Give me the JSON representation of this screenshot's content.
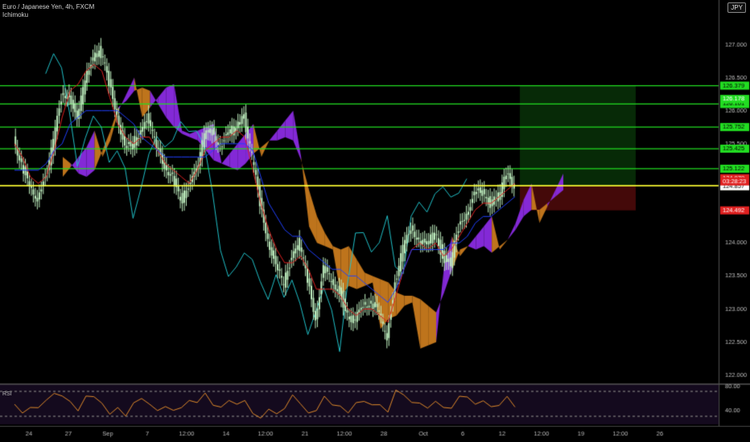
{
  "header": {
    "symbol_title": "Euro / Japanese Yen, 4h, FXCM",
    "indicator": "Ichimoku",
    "currency_badge": "JPY"
  },
  "rsi_panel": {
    "label": "RSI",
    "upper_level": "80.00",
    "lower_level": "40.00"
  },
  "colors": {
    "background": "#000000",
    "kumo_bullish": "#c87a1e",
    "kumo_bearish": "#8a2be2",
    "tenkan": "#e02020",
    "kijun": "#2040ff",
    "chikou": "#20c0c8",
    "candles": "#c0f0c0",
    "level_line": "#22dd22",
    "entry_line": "#ffff33",
    "rsi_line": "#e08a2a"
  },
  "chart_data": {
    "type": "candlestick",
    "title": "Euro / Japanese Yen, 4h, FXCM",
    "ylim": [
      121.9,
      127.65
    ],
    "y_ticks": [
      "127.000",
      "126.500",
      "126.000",
      "125.500",
      "125.000",
      "124.500",
      "124.000",
      "123.500",
      "123.000",
      "122.500",
      "122.000"
    ],
    "x_ticks": [
      "24",
      "27",
      "Sep",
      "7",
      "12:00",
      "14",
      "12:00",
      "21",
      "12:00",
      "28",
      "Oct",
      "6",
      "12",
      "12:00",
      "19",
      "12:00",
      "26"
    ],
    "horizontal_levels": [
      {
        "value": 126.379,
        "label": "126.379",
        "color": "#22dd22"
      },
      {
        "value": 126.101,
        "label": "126.101",
        "color": "#22dd22"
      },
      {
        "value": 125.752,
        "label": "125.752",
        "color": "#22dd22"
      },
      {
        "value": 125.425,
        "label": "125.425",
        "color": "#22dd22"
      },
      {
        "value": 125.122,
        "label": "125.122",
        "color": "#22dd22"
      },
      {
        "value": 124.864,
        "label": "124.864",
        "color": "#ffff33"
      }
    ],
    "price_labels": [
      {
        "value": 126.178,
        "label": "126.178",
        "color": "#22dd22"
      },
      {
        "value": 124.979,
        "label": "124.979",
        "color": "#e02020"
      },
      {
        "value": 124.857,
        "label": "124.857",
        "color": "#ffffff"
      },
      {
        "value": 124.492,
        "label": "124.492",
        "color": "#e02020"
      }
    ],
    "countdown_label": "03:28:23",
    "position_box": {
      "entry": 124.864,
      "target": 126.379,
      "stop": 124.492,
      "start_x": "12",
      "end_x": "12:00 (after 19)"
    },
    "close_series": [
      125.6,
      125.2,
      124.8,
      124.7,
      125.0,
      125.5,
      126.2,
      126.3,
      125.8,
      126.5,
      126.8,
      126.9,
      126.4,
      126.0,
      125.4,
      125.5,
      125.7,
      125.9,
      125.4,
      125.2,
      125.0,
      124.6,
      124.9,
      125.1,
      125.6,
      125.7,
      125.5,
      125.6,
      125.8,
      125.9,
      125.3,
      124.6,
      124.1,
      123.6,
      123.4,
      123.8,
      124.0,
      123.4,
      122.9,
      123.6,
      123.4,
      123.3,
      122.9,
      122.8,
      123.1,
      123.1,
      122.9,
      122.6,
      123.4,
      123.9,
      124.2,
      124.1,
      123.9,
      124.2,
      123.8,
      123.7,
      124.2,
      124.5,
      124.7,
      124.8,
      124.6,
      124.7,
      125.0,
      124.9
    ],
    "series": [
      {
        "name": "Tenkan",
        "values": [
          125.5,
          125.3,
          125.0,
          124.9,
          125.0,
          125.4,
          125.9,
          126.3,
          126.4,
          126.6,
          126.7,
          126.6,
          126.2,
          125.8,
          125.6,
          125.5,
          125.6,
          125.6,
          125.4,
          125.2,
          125.1,
          125.0,
          124.9,
          125.1,
          125.4,
          125.5,
          125.6,
          125.6,
          125.7,
          125.6,
          125.1,
          124.6,
          124.2,
          123.9,
          123.7,
          123.7,
          123.8,
          123.6,
          123.3,
          123.3,
          123.3,
          123.2,
          123.0,
          122.9,
          123.0,
          123.0,
          122.9,
          122.8,
          123.2,
          123.6,
          123.9,
          124.0,
          123.9,
          124.0,
          123.8,
          123.9,
          124.1,
          124.3,
          124.5,
          124.6,
          124.6,
          124.7,
          124.8,
          124.9
        ]
      },
      {
        "name": "Kijun",
        "values": [
          125.1,
          125.1,
          125.1,
          125.1,
          125.2,
          125.4,
          125.5,
          125.8,
          125.9,
          126.0,
          126.0,
          126.0,
          126.0,
          126.0,
          125.9,
          125.8,
          125.6,
          125.5,
          125.4,
          125.3,
          125.3,
          125.3,
          125.3,
          125.3,
          125.3,
          125.4,
          125.5,
          125.5,
          125.5,
          125.5,
          125.4,
          125.0,
          124.6,
          124.4,
          124.2,
          124.1,
          124.1,
          123.9,
          123.8,
          123.7,
          123.6,
          123.6,
          123.5,
          123.5,
          123.4,
          123.3,
          123.2,
          123.1,
          123.3,
          123.6,
          123.9,
          123.9,
          123.9,
          123.9,
          123.9,
          124.0,
          124.0,
          124.1,
          124.3,
          124.4,
          124.4,
          124.5,
          124.6,
          124.7
        ]
      }
    ]
  }
}
